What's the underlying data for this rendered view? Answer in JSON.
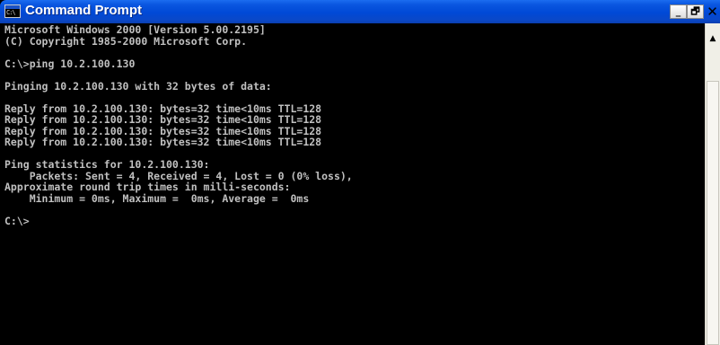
{
  "window": {
    "title": "Command Prompt",
    "icon": "console-icon",
    "icon_text": "C:\\"
  },
  "titlebar_buttons": {
    "minimize": "_",
    "maximize": "🗗",
    "close": "✕"
  },
  "console": {
    "lines": [
      "Microsoft Windows 2000 [Version 5.00.2195]",
      "(C) Copyright 1985-2000 Microsoft Corp.",
      "",
      "C:\\>ping 10.2.100.130",
      "",
      "Pinging 10.2.100.130 with 32 bytes of data:",
      "",
      "Reply from 10.2.100.130: bytes=32 time<10ms TTL=128",
      "Reply from 10.2.100.130: bytes=32 time<10ms TTL=128",
      "Reply from 10.2.100.130: bytes=32 time<10ms TTL=128",
      "Reply from 10.2.100.130: bytes=32 time<10ms TTL=128",
      "",
      "Ping statistics for 10.2.100.130:",
      "    Packets: Sent = 4, Received = 4, Lost = 0 (0% loss),",
      "Approximate round trip times in milli-seconds:",
      "    Minimum = 0ms, Maximum =  0ms, Average =  0ms",
      "",
      "C:\\>"
    ]
  },
  "scrollbar": {
    "up_arrow": "▲"
  },
  "colors": {
    "titlebar": "#0a54e0",
    "console_bg": "#000000",
    "console_fg": "#c0c0c0"
  }
}
